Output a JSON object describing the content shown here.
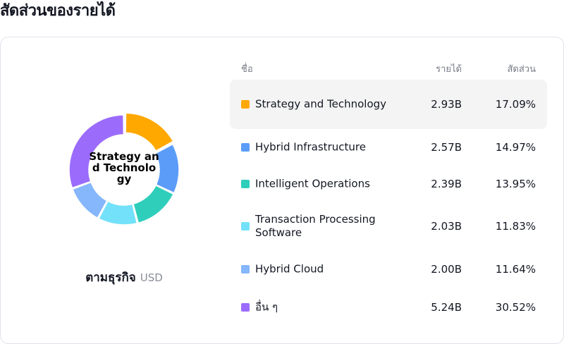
{
  "page": {
    "title": "สัดส่วนของรายได้"
  },
  "donut": {
    "center_label": "Strategy and Technology",
    "caption": "ตามธุรกิจ",
    "unit": "USD"
  },
  "table": {
    "headers": {
      "name": "ชื่อ",
      "revenue": "รายได้",
      "share": "สัดส่วน"
    },
    "rows": [
      {
        "name": "Strategy and Technology",
        "revenue": "2.93B",
        "share": "17.09%",
        "color": "#ffa800",
        "highlighted": true
      },
      {
        "name": "Hybrid Infrastructure",
        "revenue": "2.57B",
        "share": "14.97%",
        "color": "#5b9cf8",
        "highlighted": false
      },
      {
        "name": "Intelligent Operations",
        "revenue": "2.39B",
        "share": "13.95%",
        "color": "#2fcebb",
        "highlighted": false
      },
      {
        "name": "Transaction Processing Software",
        "revenue": "2.03B",
        "share": "11.83%",
        "color": "#74e1fa",
        "highlighted": false
      },
      {
        "name": "Hybrid Cloud",
        "revenue": "2.00B",
        "share": "11.64%",
        "color": "#86b6fb",
        "highlighted": false
      },
      {
        "name": "อื่น ๆ",
        "revenue": "5.24B",
        "share": "30.52%",
        "color": "#9b6cfb",
        "highlighted": false
      }
    ]
  },
  "chart_data": {
    "type": "pie",
    "categories": [
      "Strategy and Technology",
      "Hybrid Infrastructure",
      "Intelligent Operations",
      "Transaction Processing Software",
      "Hybrid Cloud",
      "อื่น ๆ"
    ],
    "values": [
      17.09,
      14.97,
      13.95,
      11.83,
      11.64,
      30.52
    ],
    "colors": [
      "#ffa800",
      "#5b9cf8",
      "#2fcebb",
      "#74e1fa",
      "#86b6fb",
      "#9b6cfb"
    ],
    "highlighted_index": 0
  }
}
